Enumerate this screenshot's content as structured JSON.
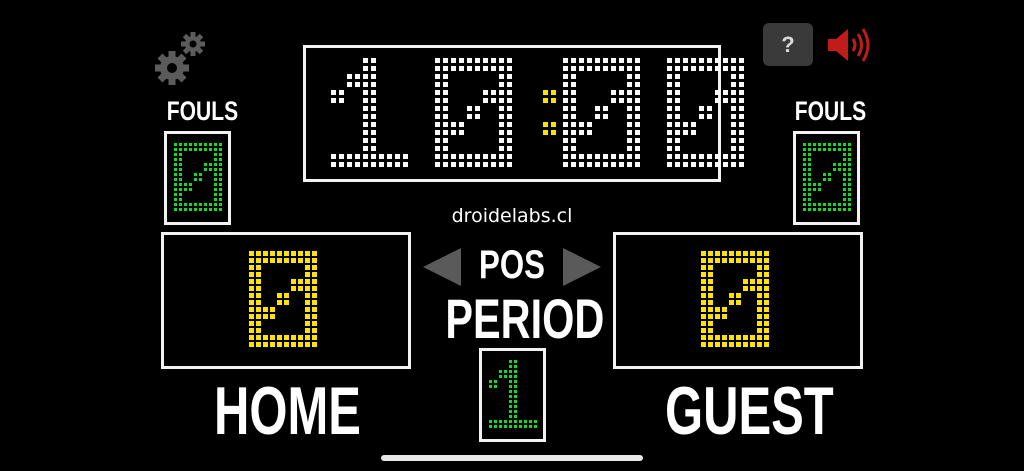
{
  "clock": {
    "minutes": "10",
    "separator": ":",
    "seconds": "00",
    "digit_color": "#ffffff",
    "colon_color": "#ffe300"
  },
  "fouls": {
    "home": {
      "label": "FOULS",
      "value": "0"
    },
    "guest": {
      "label": "FOULS",
      "value": "0"
    },
    "digit_color": "#17d62a"
  },
  "score": {
    "home": {
      "value": "0",
      "name": "HOME"
    },
    "guest": {
      "value": "0",
      "name": "GUEST"
    },
    "digit_color": "#ffe300"
  },
  "center": {
    "website": "droidelabs.cl",
    "possession_label": "POS",
    "period_label": "PERIOD",
    "period_value": "1",
    "period_color": "#17d62a",
    "arrow_color": "#5a5a5a"
  },
  "toolbar": {
    "settings_icon": "gears-icon",
    "help_label": "?",
    "sound_icon": "speaker-icon",
    "sound_color": "#c21b1b"
  }
}
